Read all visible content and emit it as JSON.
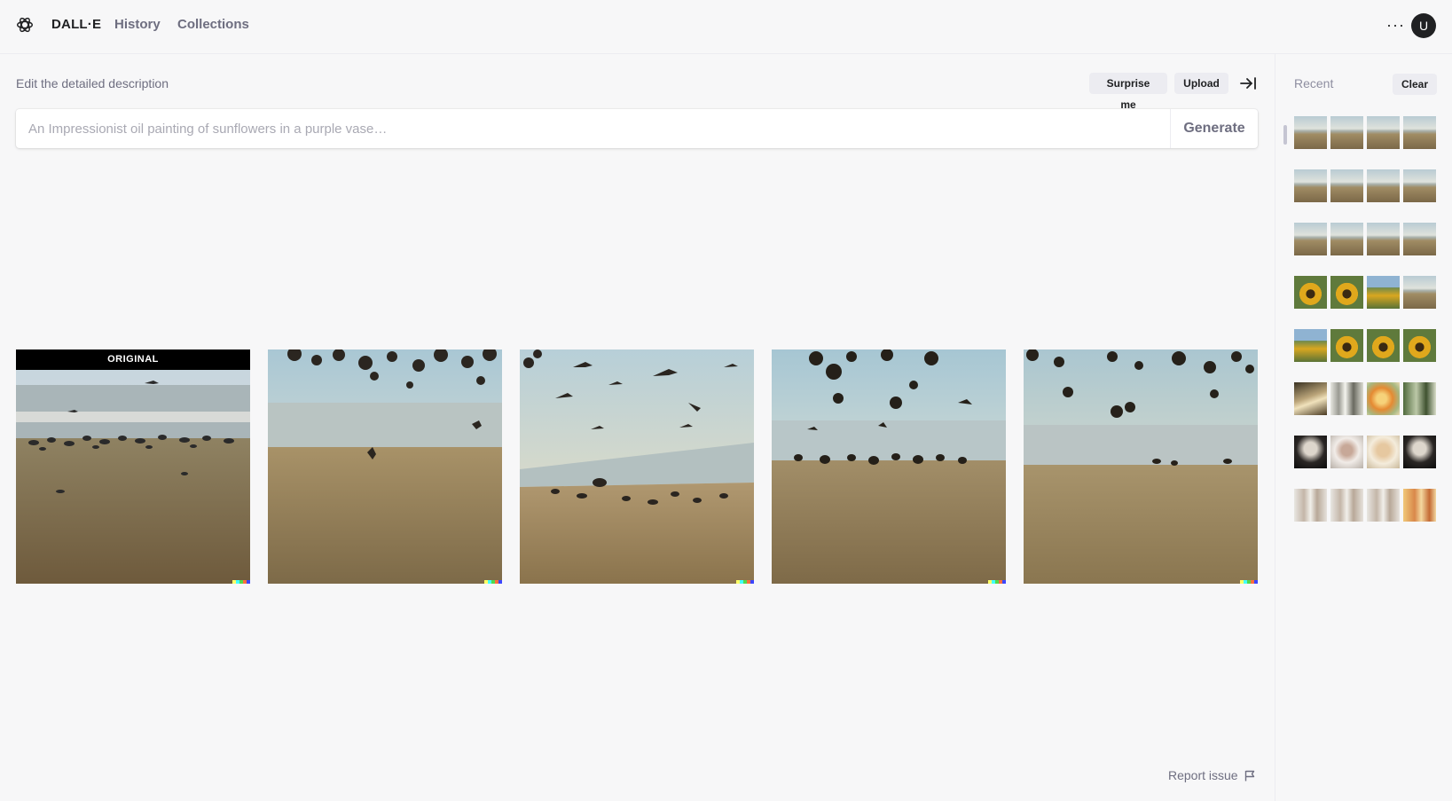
{
  "header": {
    "brand": "DALL·E",
    "nav": [
      {
        "label": "History"
      },
      {
        "label": "Collections"
      }
    ],
    "more": "···",
    "avatar_initial": "U"
  },
  "main": {
    "prompt_label": "Edit the detailed description",
    "surprise_label": "Surprise me",
    "upload_label": "Upload",
    "input_placeholder": "An Impressionist oil painting of sunflowers in a purple vase…",
    "input_value": "",
    "generate_label": "Generate",
    "original_label": "ORIGINAL",
    "report_label": "Report issue"
  },
  "images": [
    {
      "name": "original-image",
      "kind": "beach-birds-low"
    },
    {
      "name": "variation-1",
      "kind": "beach-leaves"
    },
    {
      "name": "variation-2",
      "kind": "beach-birds-sky"
    },
    {
      "name": "variation-3",
      "kind": "beach-leaves-flock"
    },
    {
      "name": "variation-4",
      "kind": "beach-leaves-empty"
    }
  ],
  "sidebar": {
    "recent_label": "Recent",
    "clear_label": "Clear",
    "thumb_rows": [
      [
        "beach",
        "beach",
        "beach",
        "beach"
      ],
      [
        "beach",
        "beach",
        "beach",
        "beach"
      ],
      [
        "beach",
        "beach",
        "beach",
        "beach"
      ],
      [
        "sunflower",
        "sunflower",
        "sunflower-field",
        "beach"
      ],
      [
        "sunflower-field",
        "sunflower",
        "sunflower",
        "sunflower"
      ],
      [
        "abstract-gold",
        "abstract-light",
        "abstract-orange",
        "abstract-green"
      ],
      [
        "portrait-dark",
        "portrait-light",
        "portrait-sketch",
        "portrait-dark"
      ],
      [
        "legs",
        "legs",
        "legs",
        "legs-warm"
      ]
    ]
  },
  "colors": {
    "background": "#f7f7f8",
    "text": "#202123",
    "muted": "#6e6e80",
    "chip": "#ececf1"
  },
  "icons": [
    "openai-logo-icon",
    "more-icon",
    "collapse-sidebar-icon",
    "flag-icon"
  ]
}
